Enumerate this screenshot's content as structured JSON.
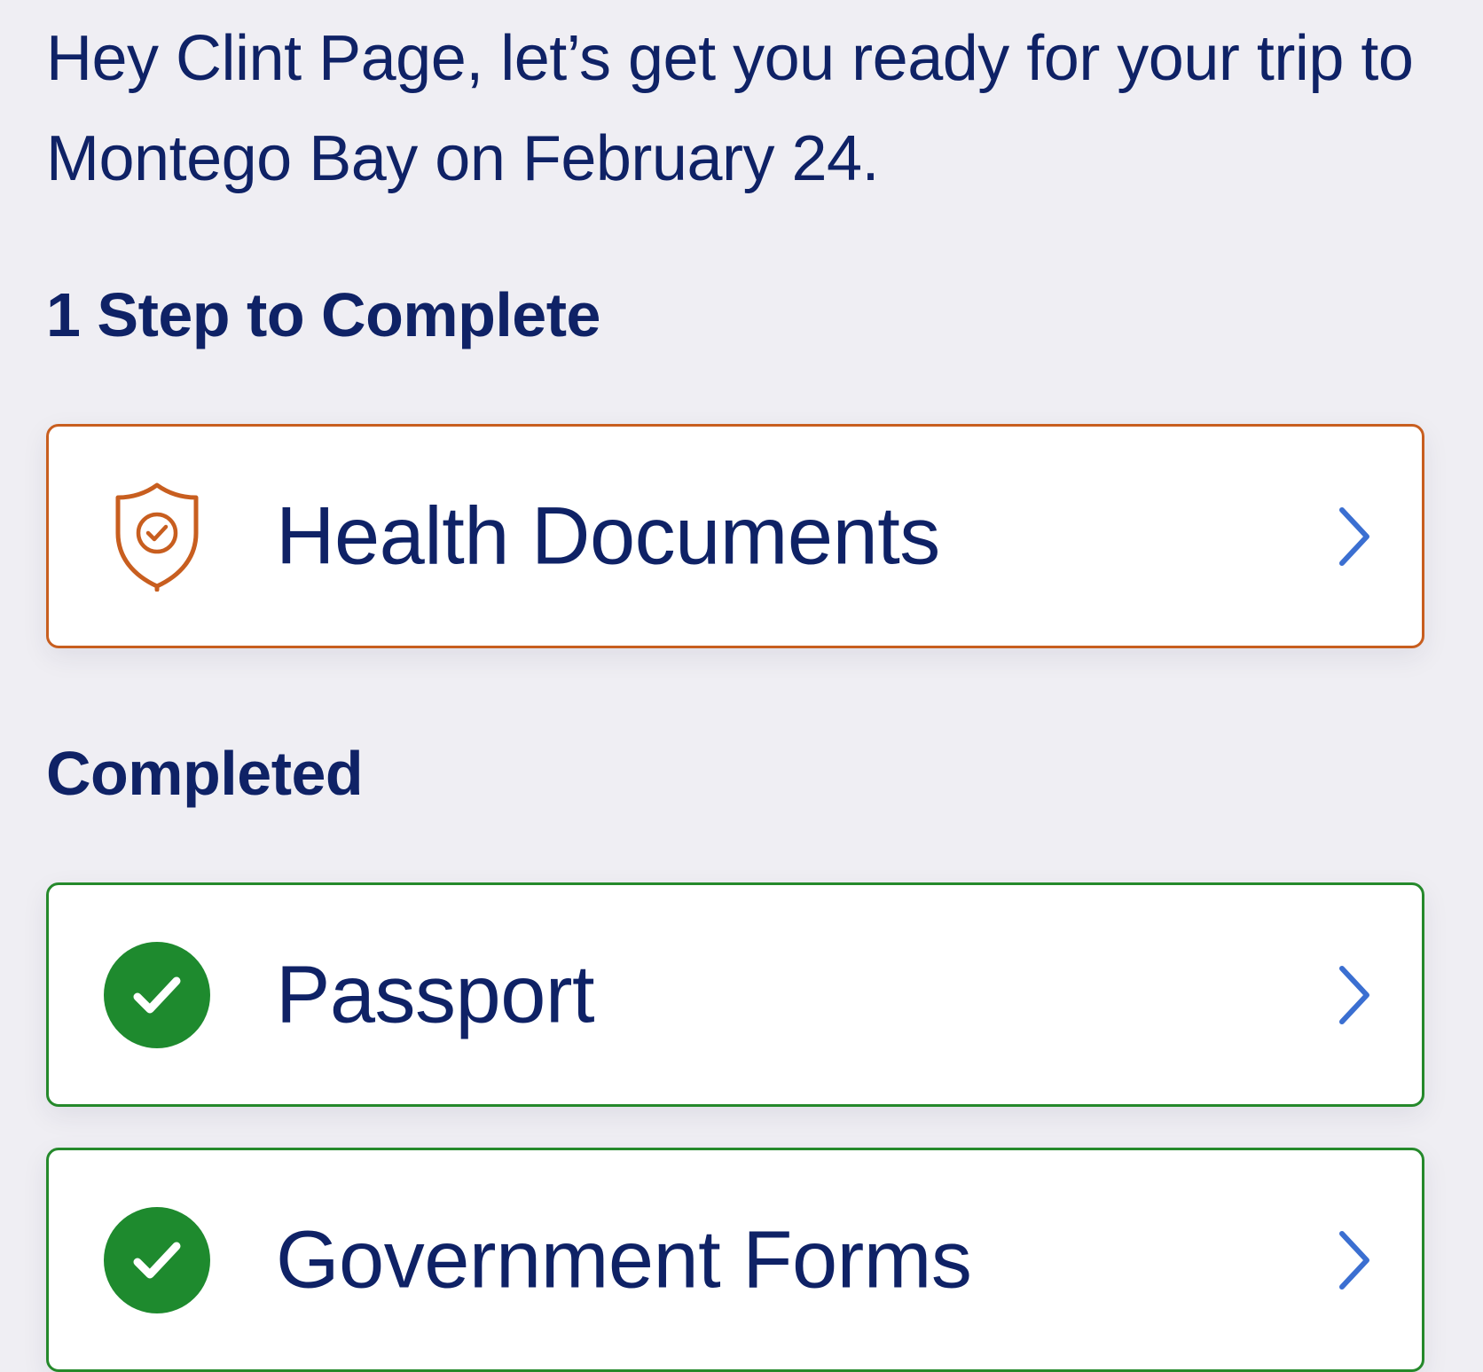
{
  "greeting": "Hey Clint Page, let’s get you ready for your trip to Montego Bay on February 24.",
  "todo_section": {
    "heading": "1 Step to Complete",
    "items": [
      {
        "label": "Health Documents",
        "icon": "shield-check-icon",
        "status": "pending"
      }
    ]
  },
  "completed_section": {
    "heading": "Completed",
    "items": [
      {
        "label": "Passport",
        "icon": "check-circle-icon",
        "status": "completed"
      },
      {
        "label": "Government Forms",
        "icon": "check-circle-icon",
        "status": "completed"
      }
    ]
  },
  "colors": {
    "background": "#efeef3",
    "text": "#0f2266",
    "pending_border": "#c85e1f",
    "completed_border": "#25892b",
    "check_fill": "#1e8a2e",
    "chevron": "#3b6fd1"
  }
}
